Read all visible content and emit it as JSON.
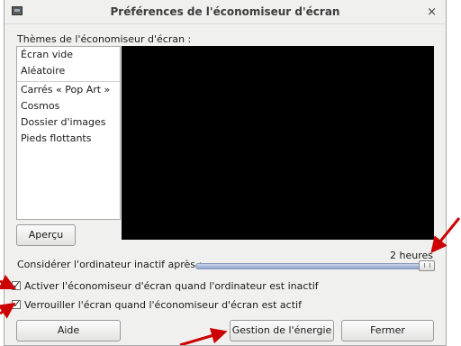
{
  "window": {
    "title": "Préférences de l'économiseur d'écran",
    "close_symbol": "×"
  },
  "themes": {
    "label": "Thèmes de l'économiseur d'écran :",
    "items": [
      "Écran vide",
      "Aléatoire",
      "Carrés « Pop Art »",
      "Cosmos",
      "Dossier d'images",
      "Pieds flottants"
    ]
  },
  "preview": {
    "button_label": "Aperçu"
  },
  "idle": {
    "label": "Considérer l'ordinateur inactif après :",
    "value_label": "2 heures",
    "slider_fraction": 1.0
  },
  "options": {
    "activate": {
      "label": "Activer l'économiseur d'écran quand l'ordinateur est inactif",
      "checked": true
    },
    "lock": {
      "label": "Verrouiller l'écran quand l'économiseur d'écran est actif",
      "checked": true
    }
  },
  "buttons": {
    "help": "Aide",
    "power": "Gestion de l'énergie",
    "close": "Fermer"
  },
  "colors": {
    "annotation_arrow": "#cc0000",
    "preview_background": "#000000"
  }
}
